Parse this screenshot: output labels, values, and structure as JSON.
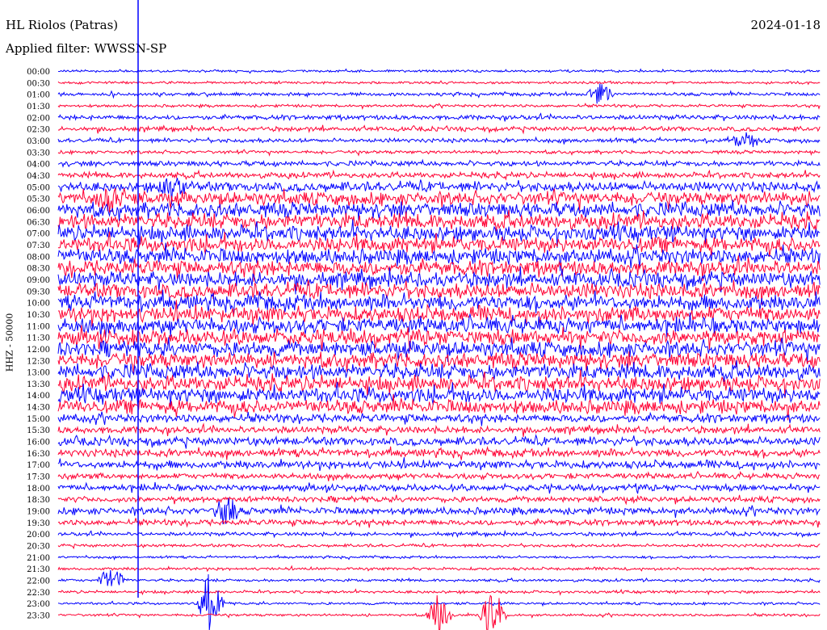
{
  "header": {
    "station": "HL Riolos (Patras)",
    "date": "2024-01-18",
    "filter": "Applied filter: WWSSN-SP"
  },
  "colors": {
    "line_a": "#0000ff",
    "line_b": "#ff0033",
    "text": "#000000"
  },
  "chart_data": {
    "type": "line",
    "title": "HL Riolos (Patras)",
    "ylabel": "HHZ - 50000",
    "trace_colors": [
      "blue",
      "red"
    ],
    "rows": [
      {
        "label": "00:00",
        "activity": 0.05
      },
      {
        "label": "00:30",
        "activity": 0.05
      },
      {
        "label": "01:00",
        "activity": 0.12
      },
      {
        "label": "01:30",
        "activity": 0.08
      },
      {
        "label": "02:00",
        "activity": 0.22
      },
      {
        "label": "02:30",
        "activity": 0.22
      },
      {
        "label": "03:00",
        "activity": 0.18
      },
      {
        "label": "03:30",
        "activity": 0.12
      },
      {
        "label": "04:00",
        "activity": 0.25
      },
      {
        "label": "04:30",
        "activity": 0.3
      },
      {
        "label": "05:00",
        "activity": 0.6
      },
      {
        "label": "05:30",
        "activity": 0.85
      },
      {
        "label": "06:00",
        "activity": 0.95
      },
      {
        "label": "06:30",
        "activity": 1.0
      },
      {
        "label": "07:00",
        "activity": 1.0
      },
      {
        "label": "07:30",
        "activity": 1.0
      },
      {
        "label": "08:00",
        "activity": 1.0
      },
      {
        "label": "08:30",
        "activity": 1.0
      },
      {
        "label": "09:00",
        "activity": 1.0
      },
      {
        "label": "09:30",
        "activity": 1.0
      },
      {
        "label": "10:00",
        "activity": 1.0
      },
      {
        "label": "10:30",
        "activity": 1.0
      },
      {
        "label": "11:00",
        "activity": 1.0
      },
      {
        "label": "11:30",
        "activity": 1.0
      },
      {
        "label": "12:00",
        "activity": 1.0
      },
      {
        "label": "12:30",
        "activity": 1.0
      },
      {
        "label": "13:00",
        "activity": 1.0
      },
      {
        "label": "13:30",
        "activity": 1.0
      },
      {
        "label": "14:00",
        "activity": 1.0
      },
      {
        "label": "14:30",
        "activity": 0.9
      },
      {
        "label": "15:00",
        "activity": 0.5
      },
      {
        "label": "15:30",
        "activity": 0.4
      },
      {
        "label": "16:00",
        "activity": 0.5
      },
      {
        "label": "16:30",
        "activity": 0.45
      },
      {
        "label": "17:00",
        "activity": 0.45
      },
      {
        "label": "17:30",
        "activity": 0.3
      },
      {
        "label": "18:00",
        "activity": 0.35
      },
      {
        "label": "18:30",
        "activity": 0.3
      },
      {
        "label": "19:00",
        "activity": 0.4
      },
      {
        "label": "19:30",
        "activity": 0.3
      },
      {
        "label": "20:00",
        "activity": 0.15
      },
      {
        "label": "20:30",
        "activity": 0.1
      },
      {
        "label": "21:00",
        "activity": 0.05
      },
      {
        "label": "21:30",
        "activity": 0.08
      },
      {
        "label": "22:00",
        "activity": 0.08
      },
      {
        "label": "22:30",
        "activity": 0.08
      },
      {
        "label": "23:00",
        "activity": 0.06
      },
      {
        "label": "23:30",
        "activity": 0.06
      }
    ],
    "events": [
      {
        "row": 2,
        "t": 0.71,
        "amp": 1.2
      },
      {
        "row": 10,
        "t": 0.15,
        "amp": 1.4
      },
      {
        "row": 11,
        "t": 0.07,
        "amp": 1.8
      },
      {
        "row": 6,
        "t": 0.9,
        "amp": 1.0
      },
      {
        "row": 44,
        "t": 0.07,
        "amp": 1.4
      },
      {
        "row": 38,
        "t": 0.22,
        "amp": 1.6
      },
      {
        "row": 46,
        "t": 0.2,
        "amp": 3.6
      },
      {
        "row": 47,
        "t": 0.5,
        "amp": 2.2
      },
      {
        "row": 47,
        "t": 0.57,
        "amp": 2.6
      }
    ],
    "grid": false
  }
}
